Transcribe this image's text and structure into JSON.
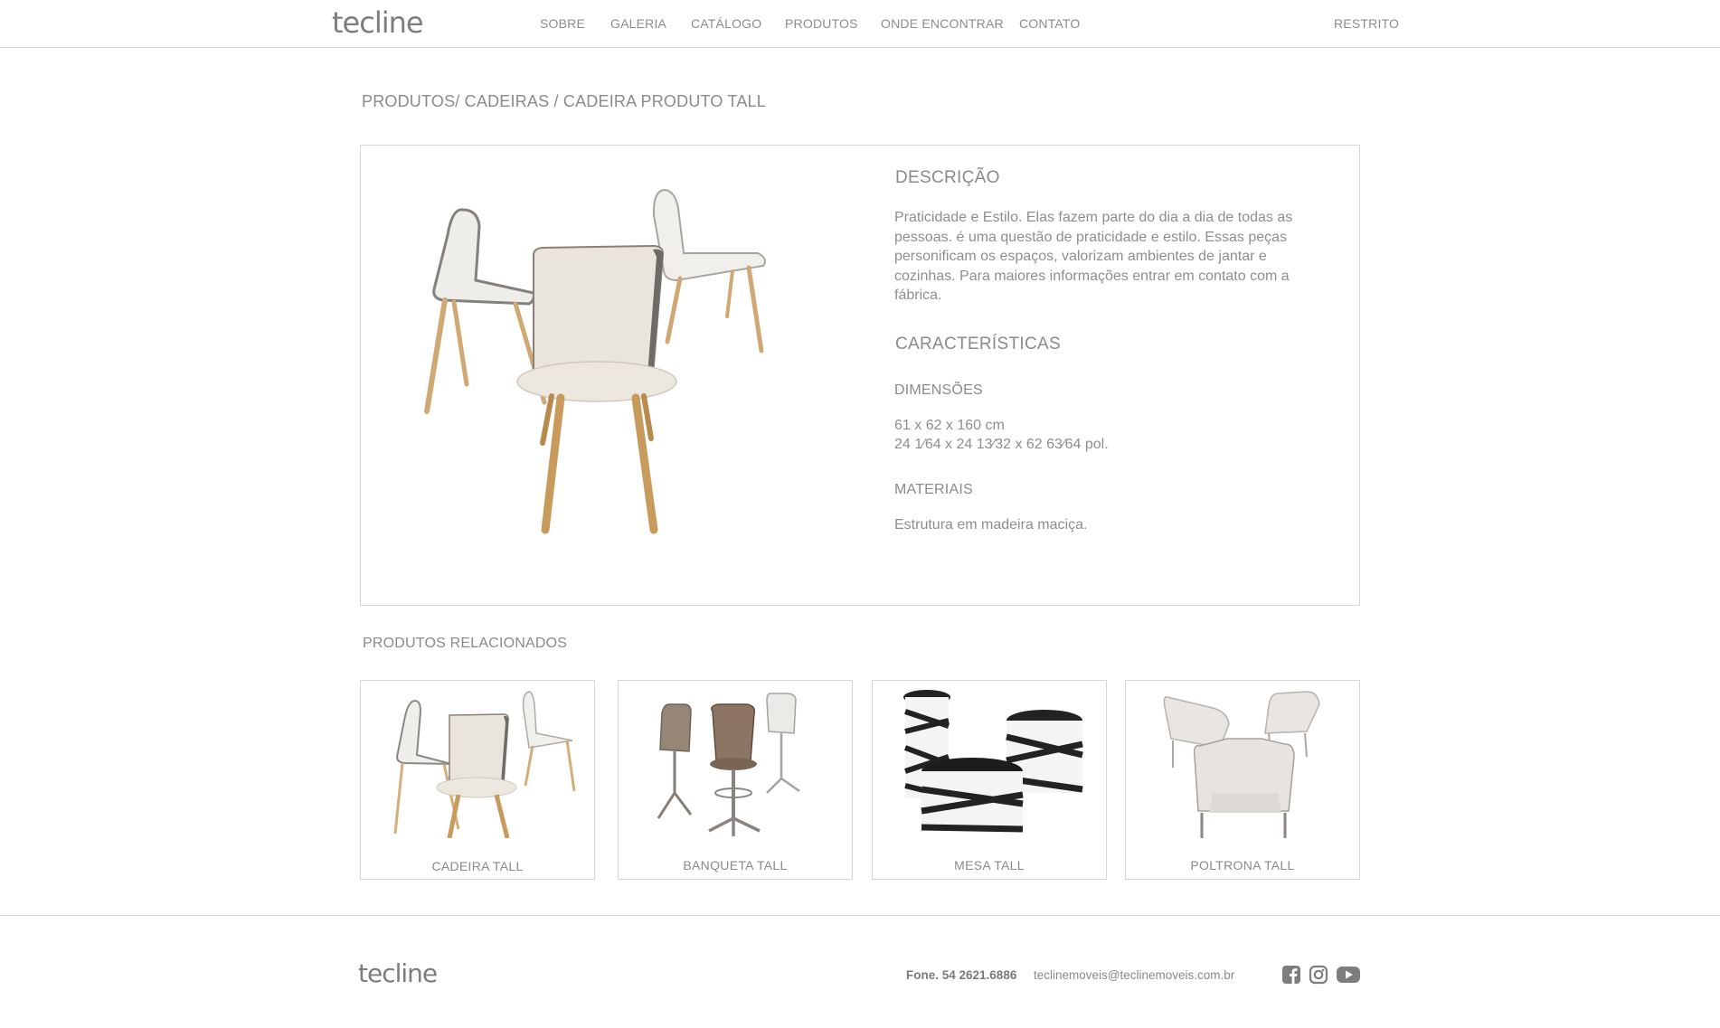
{
  "header": {
    "logo": "tecline",
    "nav": [
      "SOBRE",
      "GALERIA",
      "CATÁLOGO",
      "PRODUTOS",
      "ONDE ENCONTRAR",
      "CONTATO"
    ],
    "restricted": "RESTRITO"
  },
  "breadcrumb": "PRODUTOS/ CADEIRAS / CADEIRA PRODUTO TALL",
  "product": {
    "description_title": "DESCRIÇÃO",
    "description_text": "Praticidade e Estilo. Elas fazem parte do dia a dia de todas as pessoas. é uma questão de praticidade e estilo. Essas peças personificam os espaços, valorizam ambientes de jantar e cozinhas. Para maiores informações entrar em contato com a fábrica.",
    "features_title": "CARACTERÍSTICAS",
    "dimensions_title": "DIMENSÕES",
    "dimensions_cm": "61 x 62 x 160 cm",
    "dimensions_in": "24 1⁄64 x 24 13⁄32 x 62 63⁄64 pol.",
    "materials_title": "MATERIAIS",
    "materials_text": "Estrutura em madeira maciça."
  },
  "related": {
    "title": "PRODUTOS RELACIONADOS",
    "items": [
      {
        "label": "CADEIRA TALL",
        "image": "chair-image"
      },
      {
        "label": "BANQUETA TALL",
        "image": "stool-image"
      },
      {
        "label": "MESA TALL",
        "image": "table-image"
      },
      {
        "label": "POLTRONA TALL",
        "image": "armchair-image"
      }
    ]
  },
  "footer": {
    "logo": "tecline",
    "phone": "Fone. 54 2621.6886",
    "email": "teclinemoveis@teclinemoveis.com.br",
    "social": [
      "facebook-icon",
      "instagram-icon",
      "youtube-icon"
    ]
  },
  "colors": {
    "text": "#8a8a8a",
    "border": "#d6d6d6",
    "wood": "#c89a5c",
    "fabric": "#e9e5dd"
  }
}
